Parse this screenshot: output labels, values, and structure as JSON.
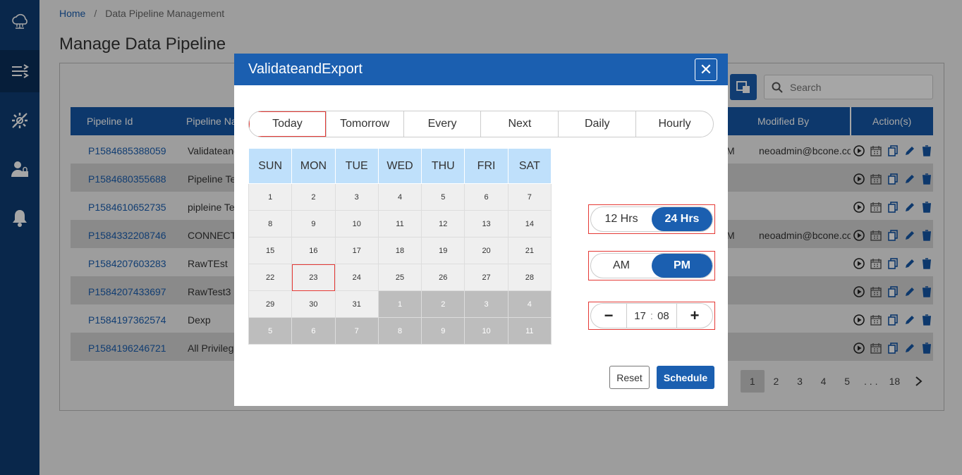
{
  "breadcrumb": {
    "home": "Home",
    "sep": "/",
    "current": "Data Pipeline Management"
  },
  "page_title": "Manage Data Pipeline",
  "search": {
    "placeholder": "Search"
  },
  "table": {
    "headers": {
      "id": "Pipeline Id",
      "name": "Pipeline Na",
      "modified_by": "Modified By",
      "actions": "Action(s)"
    },
    "rows": [
      {
        "id": "P1584685388059",
        "name": "Validateand",
        "mm": "M",
        "modified_by": "neoadmin@bcone.co"
      },
      {
        "id": "P1584680355688",
        "name": "Pipeline Te",
        "mm": "",
        "modified_by": ""
      },
      {
        "id": "P1584610652735",
        "name": "pipleine Te",
        "mm": "",
        "modified_by": ""
      },
      {
        "id": "P1584332208746",
        "name": "CONNECTI",
        "mm": "M",
        "modified_by": "neoadmin@bcone.co"
      },
      {
        "id": "P1584207603283",
        "name": "RawTEst",
        "mm": "",
        "modified_by": ""
      },
      {
        "id": "P1584207433697",
        "name": "RawTest3",
        "mm": "",
        "modified_by": ""
      },
      {
        "id": "P1584197362574",
        "name": "Dexp",
        "mm": "",
        "modified_by": ""
      },
      {
        "id": "P1584196246721",
        "name": "All Privilege",
        "mm": "",
        "modified_by": ""
      }
    ]
  },
  "pager": {
    "pages": [
      "1",
      "2",
      "3",
      "4",
      "5",
      ". . .",
      "18"
    ],
    "current": "1",
    "next": ">"
  },
  "modal": {
    "title": "ValidateandExport",
    "close": "✕",
    "tabs": [
      "Today",
      "Tomorrow",
      "Every",
      "Next",
      "Daily",
      "Hourly"
    ],
    "selected_tab": "Today",
    "calendar": {
      "weekdays": [
        "SUN",
        "MON",
        "TUE",
        "WED",
        "THU",
        "FRI",
        "SAT"
      ],
      "weeks": [
        [
          "1",
          "2",
          "3",
          "4",
          "5",
          "6",
          "7"
        ],
        [
          "8",
          "9",
          "10",
          "11",
          "12",
          "13",
          "14"
        ],
        [
          "15",
          "16",
          "17",
          "18",
          "19",
          "20",
          "21"
        ],
        [
          "22",
          "23",
          "24",
          "25",
          "26",
          "27",
          "28"
        ],
        [
          "29",
          "30",
          "31",
          "1",
          "2",
          "3",
          "4"
        ],
        [
          "5",
          "6",
          "7",
          "8",
          "9",
          "10",
          "11"
        ]
      ],
      "today": "23"
    },
    "hour_format": {
      "options": [
        "12 Hrs",
        "24 Hrs"
      ],
      "selected": "24 Hrs"
    },
    "meridiem": {
      "options": [
        "AM",
        "PM"
      ],
      "selected": "PM"
    },
    "time": {
      "minus": "−",
      "hour": "17",
      "colon": ":",
      "minute": "08",
      "plus": "+"
    },
    "reset_label": "Reset",
    "schedule_label": "Schedule"
  },
  "colors": {
    "primary": "#1b5fb0",
    "sidebar": "#0f3d73",
    "highlight": "#e53935",
    "calendar_header": "#bfe0fb"
  }
}
